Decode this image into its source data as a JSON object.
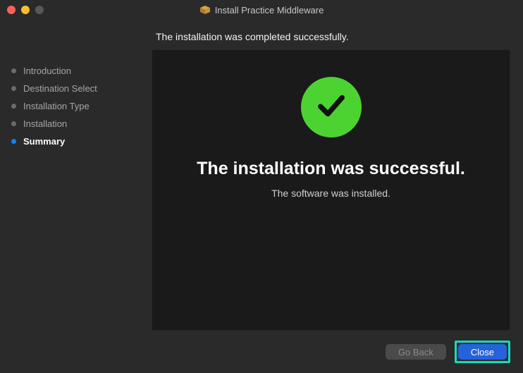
{
  "window": {
    "title": "Install Practice Middleware"
  },
  "sidebar": {
    "items": [
      {
        "label": "Introduction",
        "active": false
      },
      {
        "label": "Destination Select",
        "active": false
      },
      {
        "label": "Installation Type",
        "active": false
      },
      {
        "label": "Installation",
        "active": false
      },
      {
        "label": "Summary",
        "active": true
      }
    ]
  },
  "main": {
    "heading": "The installation was completed successfully.",
    "panel_title": "The installation was successful.",
    "panel_subtitle": "The software was installed."
  },
  "footer": {
    "go_back_label": "Go Back",
    "close_label": "Close"
  },
  "icons": {
    "package": "package-icon",
    "checkmark": "checkmark-icon"
  },
  "colors": {
    "accent": "#0a84ff",
    "success": "#4cd332",
    "primary_button": "#2662da",
    "highlight": "#18d9bc"
  }
}
